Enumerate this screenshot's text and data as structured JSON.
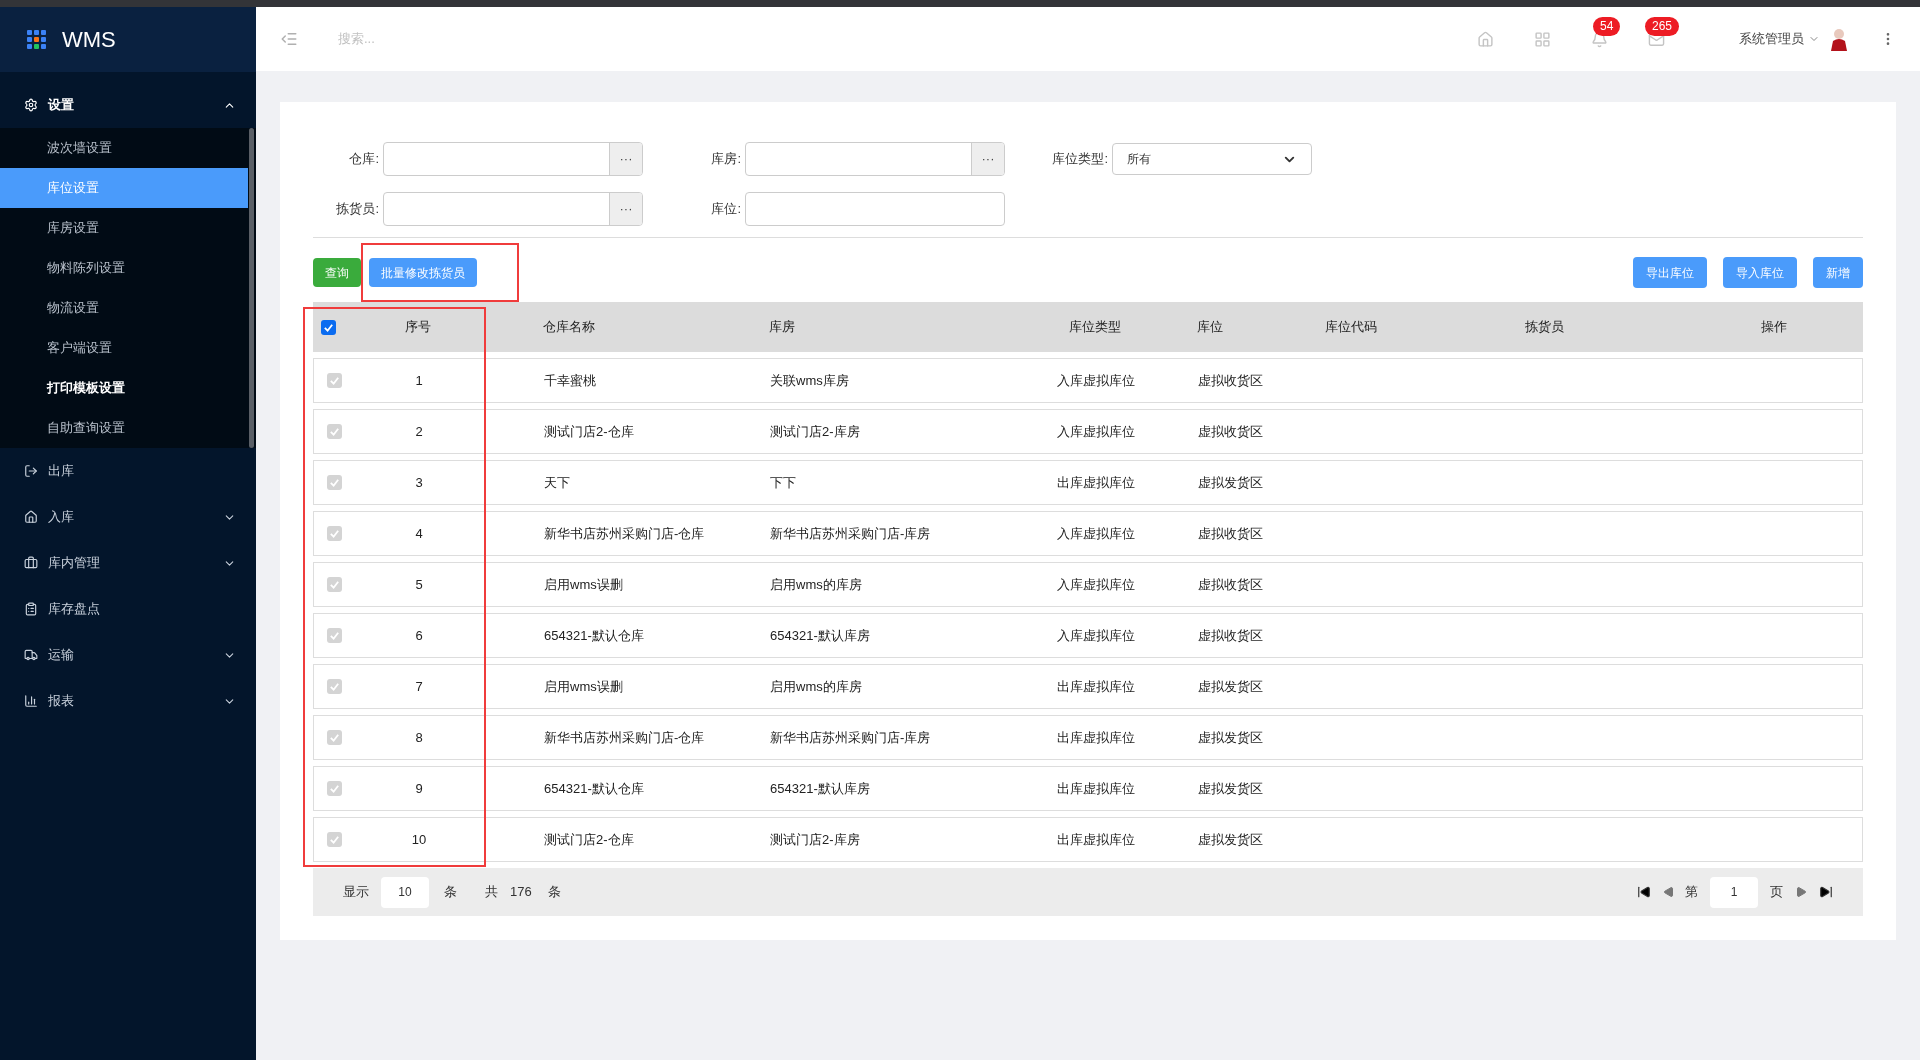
{
  "app": {
    "title": "WMS"
  },
  "sidebar": {
    "items": [
      {
        "label": "设置",
        "expanded": true,
        "selected": false,
        "children": [
          {
            "label": "波次墙设置",
            "selected": false,
            "highlighted": false
          },
          {
            "label": "库位设置",
            "selected": true,
            "highlighted": false
          },
          {
            "label": "库房设置",
            "selected": false,
            "highlighted": false
          },
          {
            "label": "物料陈列设置",
            "selected": false,
            "highlighted": false
          },
          {
            "label": "物流设置",
            "selected": false,
            "highlighted": false
          },
          {
            "label": "客户端设置",
            "selected": false,
            "highlighted": false
          },
          {
            "label": "打印模板设置",
            "selected": false,
            "highlighted": true
          },
          {
            "label": "自助查询设置",
            "selected": false,
            "highlighted": false
          }
        ]
      },
      {
        "label": "出库",
        "expanded": false,
        "selected": false,
        "has_children": false
      },
      {
        "label": "入库",
        "expanded": false,
        "selected": false,
        "has_children": true
      },
      {
        "label": "库内管理",
        "expanded": false,
        "selected": false,
        "has_children": true
      },
      {
        "label": "库存盘点",
        "expanded": false,
        "selected": false,
        "has_children": false
      },
      {
        "label": "运输",
        "expanded": false,
        "selected": false,
        "has_children": true
      },
      {
        "label": "报表",
        "expanded": false,
        "selected": false,
        "has_children": true
      }
    ]
  },
  "topbar": {
    "search": {
      "placeholder": "搜索..."
    },
    "notifications": "54",
    "messages": "265",
    "user": "系统管理员"
  },
  "filters": [
    {
      "label": "仓库:",
      "kind": "picker"
    },
    {
      "label": "库房:",
      "kind": "picker"
    },
    {
      "label": "库位类型:",
      "kind": "select",
      "value": "所有"
    },
    {
      "label": "拣货员:",
      "kind": "picker"
    },
    {
      "label": "库位:",
      "kind": "text"
    }
  ],
  "picker_button": "···",
  "actions_left": [
    {
      "label": "查询",
      "kind": "success",
      "highlighted": false
    },
    {
      "label": "批量修改拣货员",
      "kind": "primary",
      "highlighted": true
    }
  ],
  "actions_right": [
    {
      "label": "导出库位"
    },
    {
      "label": "导入库位"
    },
    {
      "label": "新增"
    }
  ],
  "table": {
    "all_checked": true,
    "columns": [
      "序号",
      "仓库名称",
      "库房",
      "库位类型",
      "库位",
      "库位代码",
      "拣货员",
      "操作"
    ],
    "rows": [
      {
        "checked": true,
        "cells": [
          "1",
          "千幸蜜桃",
          "关联wms库房",
          "入库虚拟库位",
          "虚拟收货区"
        ]
      },
      {
        "checked": true,
        "cells": [
          "2",
          "测试门店2-仓库",
          "测试门店2-库房",
          "入库虚拟库位",
          "虚拟收货区"
        ]
      },
      {
        "checked": true,
        "cells": [
          "3",
          "天下",
          "下下",
          "出库虚拟库位",
          "虚拟发货区"
        ]
      },
      {
        "checked": true,
        "cells": [
          "4",
          "新华书店苏州采购门店-仓库",
          "新华书店苏州采购门店-库房",
          "入库虚拟库位",
          "虚拟收货区"
        ]
      },
      {
        "checked": true,
        "cells": [
          "5",
          "启用wms误删",
          "启用wms的库房",
          "入库虚拟库位",
          "虚拟收货区"
        ]
      },
      {
        "checked": true,
        "cells": [
          "6",
          "654321-默认仓库",
          "654321-默认库房",
          "入库虚拟库位",
          "虚拟收货区"
        ]
      },
      {
        "checked": true,
        "cells": [
          "7",
          "启用wms误删",
          "启用wms的库房",
          "出库虚拟库位",
          "虚拟发货区"
        ]
      },
      {
        "checked": true,
        "cells": [
          "8",
          "新华书店苏州采购门店-仓库",
          "新华书店苏州采购门店-库房",
          "出库虚拟库位",
          "虚拟发货区"
        ]
      },
      {
        "checked": true,
        "cells": [
          "9",
          "654321-默认仓库",
          "654321-默认库房",
          "出库虚拟库位",
          "虚拟发货区"
        ]
      },
      {
        "checked": true,
        "cells": [
          "10",
          "测试门店2-仓库",
          "测试门店2-库房",
          "出库虚拟库位",
          "虚拟发货区"
        ]
      }
    ],
    "seq_column_highlighted": true
  },
  "pagination": {
    "show_label": "显示",
    "page_size": "10",
    "unit": "条",
    "total_label": "共",
    "total": "176",
    "total_unit": "条",
    "page_label": "第",
    "page": "1",
    "page_unit": "页"
  }
}
